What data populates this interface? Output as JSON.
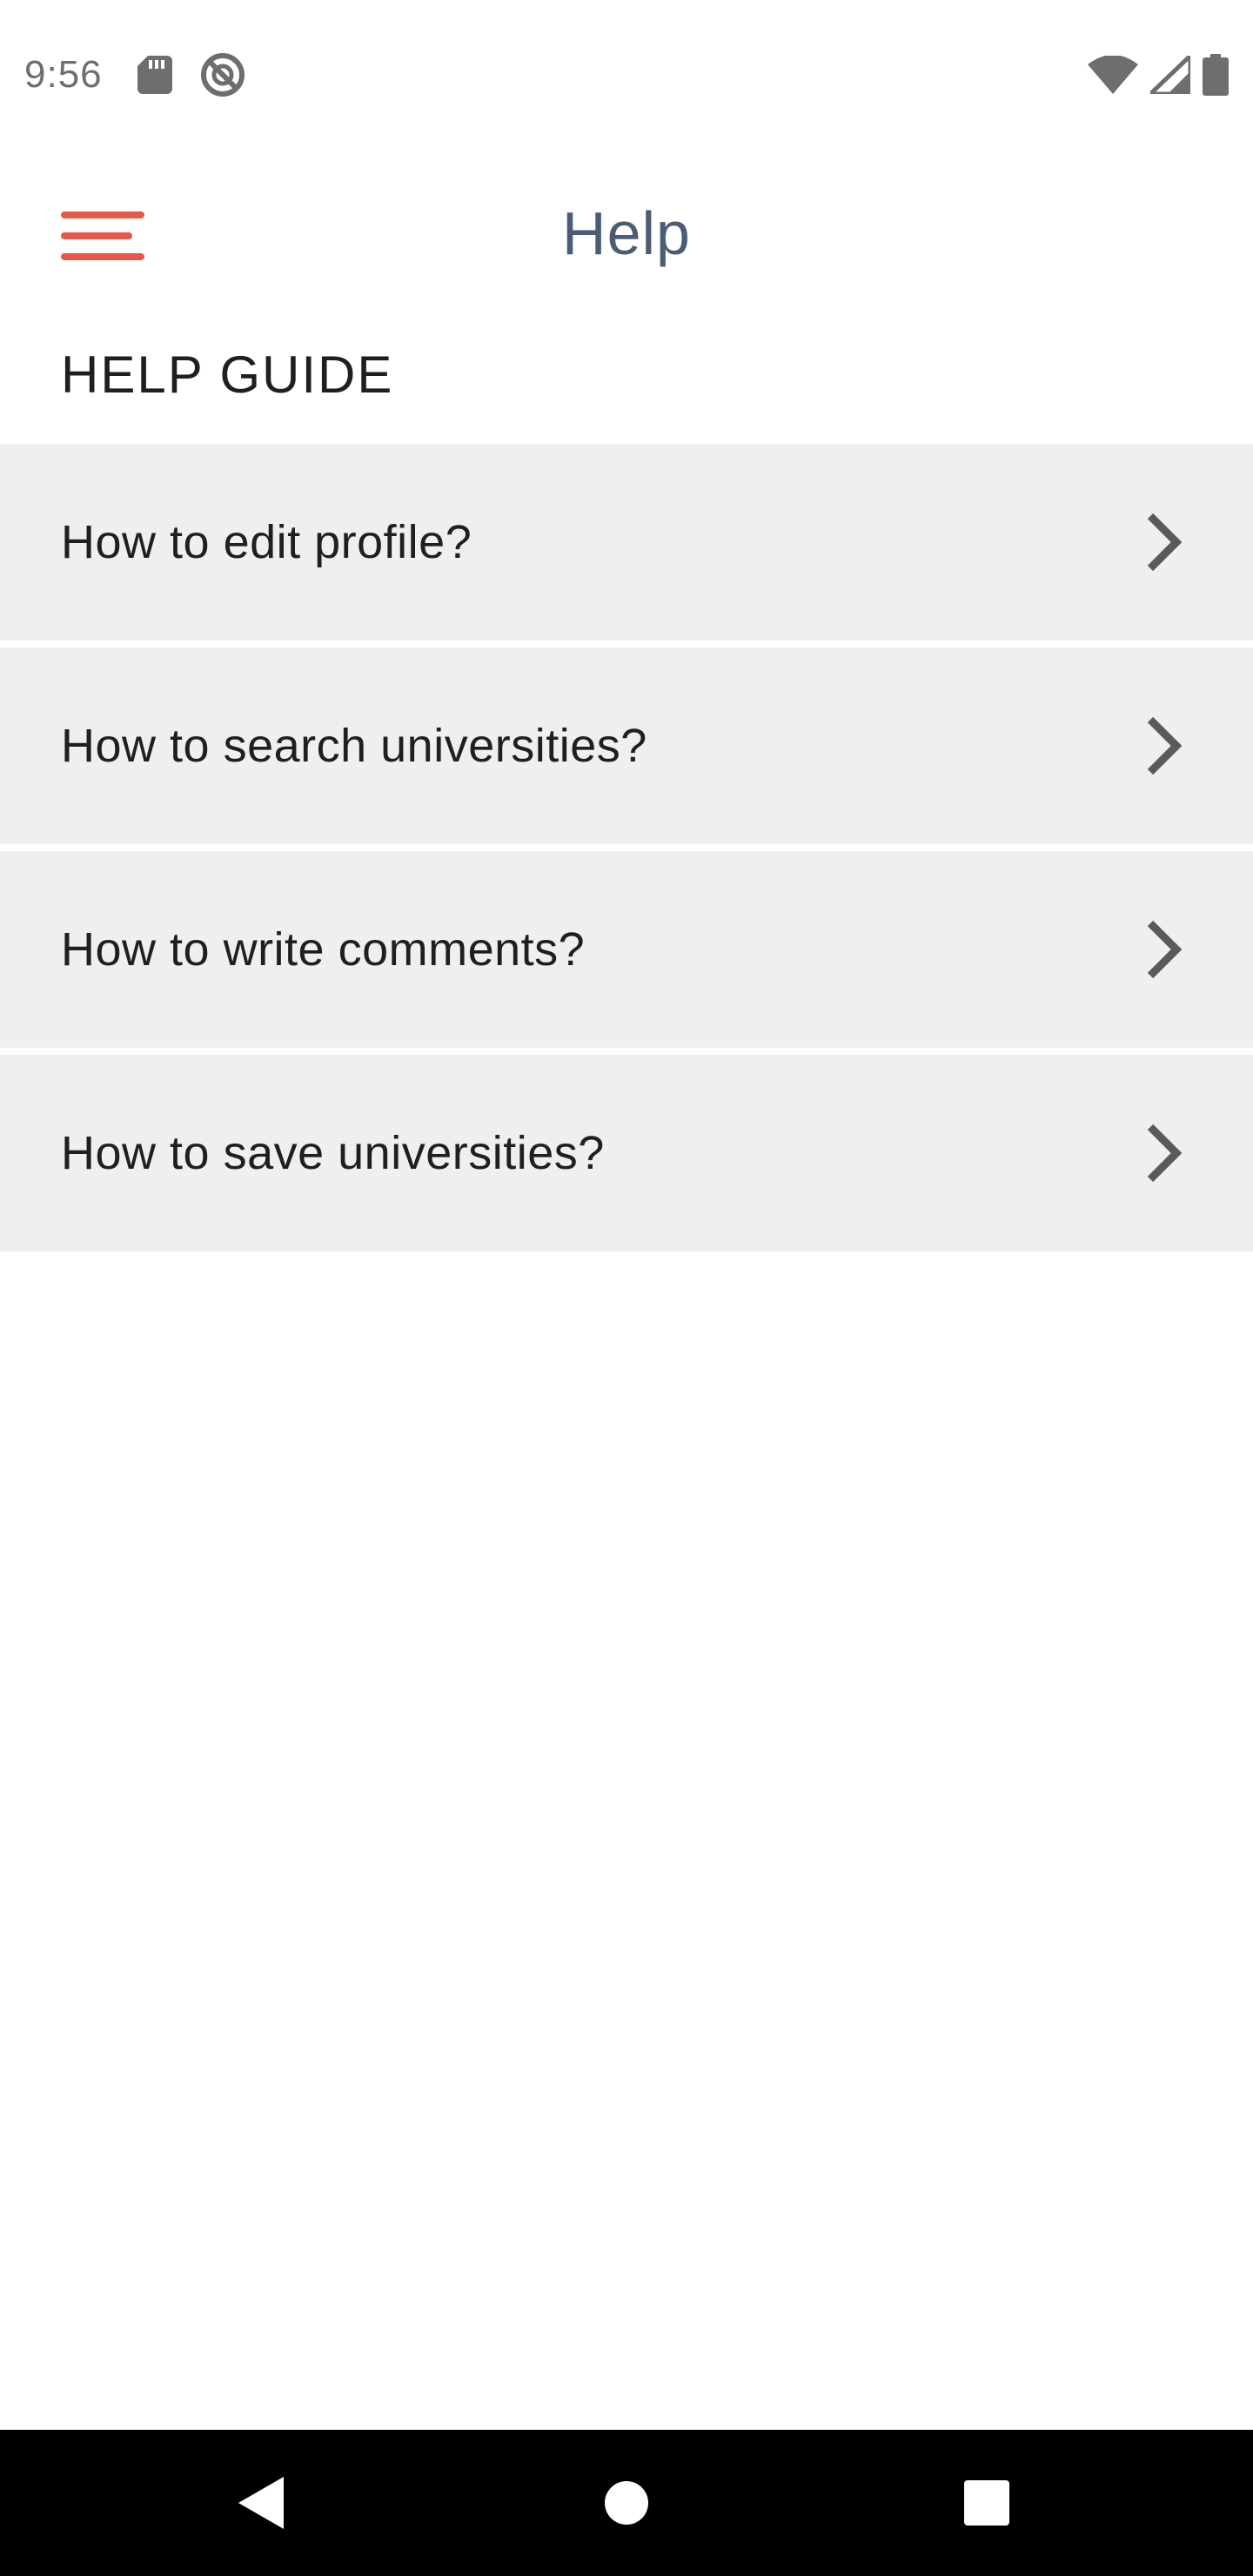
{
  "status_bar": {
    "time": "9:56",
    "left_icons": [
      "sd-card-icon",
      "do-not-disturb-icon"
    ],
    "right_icons": [
      "wifi-icon",
      "cell-signal-icon",
      "battery-icon"
    ]
  },
  "app_bar": {
    "title": "Help",
    "menu_icon": "hamburger-menu-icon",
    "accent_color": "#e8574a",
    "title_color": "#4a5d74"
  },
  "section": {
    "heading": "HELP GUIDE"
  },
  "help_items": [
    {
      "label": "How to edit profile?",
      "icon": "chevron-right-icon"
    },
    {
      "label": "How to search universities?",
      "icon": "chevron-right-icon"
    },
    {
      "label": "How to write comments?",
      "icon": "chevron-right-icon"
    },
    {
      "label": "How to save universities?",
      "icon": "chevron-right-icon"
    }
  ],
  "nav_bar": {
    "buttons": [
      "back-icon",
      "home-icon",
      "recents-icon"
    ]
  }
}
